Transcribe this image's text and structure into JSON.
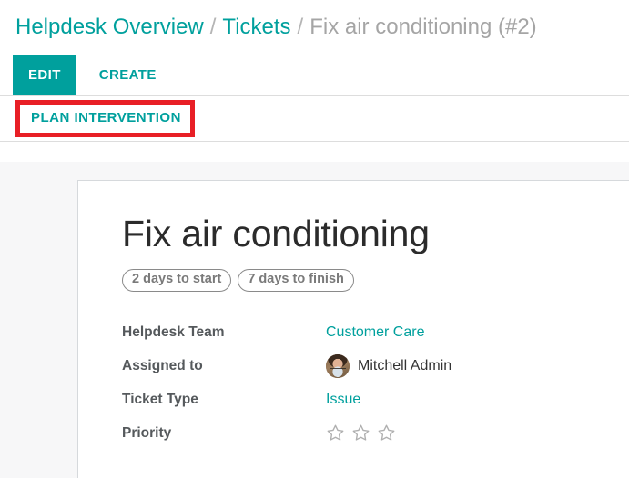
{
  "breadcrumb": {
    "items": [
      {
        "label": "Helpdesk Overview",
        "type": "link"
      },
      {
        "label": "Tickets",
        "type": "link"
      },
      {
        "label": "Fix air conditioning (#2)",
        "type": "current"
      }
    ],
    "separator": "/"
  },
  "toolbar": {
    "edit_label": "EDIT",
    "create_label": "CREATE"
  },
  "action_bar": {
    "plan_intervention_label": "PLAN INTERVENTION",
    "highlight_color": "#e81f26"
  },
  "record": {
    "title": "Fix air conditioning",
    "badges": [
      "2 days to start",
      "7 days to finish"
    ],
    "fields": [
      {
        "label": "Helpdesk Team",
        "value": "Customer Care",
        "kind": "link"
      },
      {
        "label": "Assigned to",
        "value": "Mitchell Admin",
        "kind": "avatar"
      },
      {
        "label": "Ticket Type",
        "value": "Issue",
        "kind": "link"
      },
      {
        "label": "Priority",
        "value": "0 of 3 stars",
        "kind": "stars",
        "stars_total": 3,
        "stars_filled": 0
      }
    ]
  },
  "colors": {
    "accent": "#00a09d",
    "highlight": "#e81f26",
    "text_muted": "#7a7a7a",
    "label": "#55595c"
  }
}
